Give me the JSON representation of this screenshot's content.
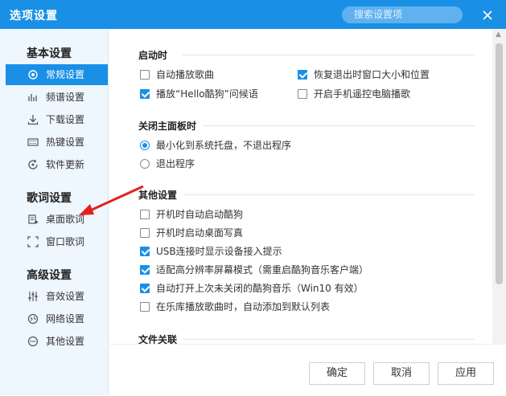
{
  "window": {
    "title": "选项设置"
  },
  "search": {
    "placeholder": "搜索设置项"
  },
  "sidebar": {
    "groups": [
      {
        "title": "基本设置",
        "items": [
          {
            "label": "常规设置",
            "icon": "gear-icon",
            "active": true
          },
          {
            "label": "频谱设置",
            "icon": "spectrum-icon"
          },
          {
            "label": "下载设置",
            "icon": "download-icon"
          },
          {
            "label": "热键设置",
            "icon": "keyboard-icon"
          },
          {
            "label": "软件更新",
            "icon": "update-icon"
          }
        ]
      },
      {
        "title": "歌词设置",
        "items": [
          {
            "label": "桌面歌词",
            "icon": "desktop-lyrics-icon"
          },
          {
            "label": "窗口歌词",
            "icon": "window-lyrics-icon"
          }
        ]
      },
      {
        "title": "高级设置",
        "items": [
          {
            "label": "音效设置",
            "icon": "equalizer-icon"
          },
          {
            "label": "网络设置",
            "icon": "network-icon"
          },
          {
            "label": "其他设置",
            "icon": "more-icon"
          }
        ]
      }
    ]
  },
  "content": {
    "startup": {
      "title": "启动时",
      "options": [
        {
          "label": "自动播放歌曲",
          "checked": false
        },
        {
          "label": "恢复退出时窗口大小和位置",
          "checked": true
        },
        {
          "label": "播放“Hello酷狗”问候语",
          "checked": true
        },
        {
          "label": "开启手机遥控电脑播歌",
          "checked": false
        }
      ]
    },
    "close_panel": {
      "title": "关闭主面板时",
      "options": [
        {
          "label": "最小化到系统托盘，不退出程序",
          "selected": true
        },
        {
          "label": "退出程序",
          "selected": false
        }
      ]
    },
    "other": {
      "title": "其他设置",
      "options": [
        {
          "label": "开机时自动启动酷狗",
          "checked": false
        },
        {
          "label": "开机时启动桌面写真",
          "checked": false
        },
        {
          "label": "USB连接时显示设备接入提示",
          "checked": true
        },
        {
          "label": "适配高分辨率屏幕模式（需重启酷狗音乐客户端）",
          "checked": true
        },
        {
          "label": "自动打开上次未关闭的酷狗音乐（Win10 有效）",
          "checked": true
        },
        {
          "label": "在乐库播放歌曲时，自动添加到默认列表",
          "checked": false
        }
      ]
    },
    "file_assoc": {
      "title": "文件关联"
    }
  },
  "buttons": {
    "ok": "确定",
    "cancel": "取消",
    "apply": "应用"
  },
  "colors": {
    "accent": "#1a8fe6",
    "arrow": "#e32020"
  }
}
